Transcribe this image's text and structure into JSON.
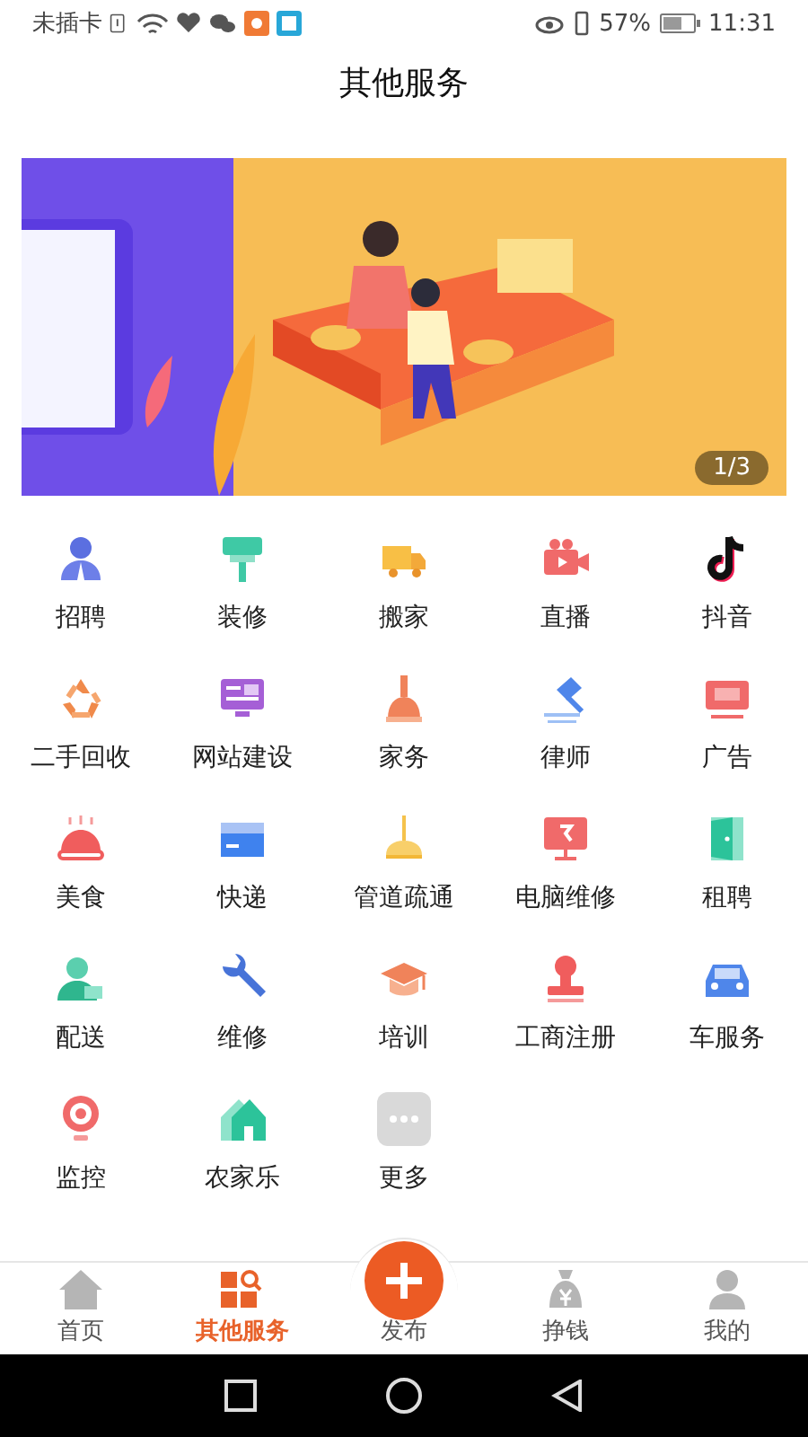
{
  "status_bar": {
    "carrier": "未插卡",
    "battery": "57%",
    "time": "11:31"
  },
  "header": {
    "title": "其他服务"
  },
  "banner": {
    "kind": "picture",
    "counter": "1/3"
  },
  "services": [
    {
      "label": "招聘"
    },
    {
      "label": "装修"
    },
    {
      "label": "搬家"
    },
    {
      "label": "直播"
    },
    {
      "label": "抖音"
    },
    {
      "label": "二手回收"
    },
    {
      "label": "网站建设"
    },
    {
      "label": "家务"
    },
    {
      "label": "律师"
    },
    {
      "label": "广告"
    },
    {
      "label": "美食"
    },
    {
      "label": "快递"
    },
    {
      "label": "管道疏通"
    },
    {
      "label": "电脑维修"
    },
    {
      "label": "租聘"
    },
    {
      "label": "配送"
    },
    {
      "label": "维修"
    },
    {
      "label": "培训"
    },
    {
      "label": "工商注册"
    },
    {
      "label": "车服务"
    },
    {
      "label": "监控"
    },
    {
      "label": "农家乐"
    },
    {
      "label": "更多"
    }
  ],
  "bottom_nav": [
    {
      "label": "首页",
      "kind": "tab",
      "selected": false
    },
    {
      "label": "其他服务",
      "kind": "tab",
      "selected": true
    },
    {
      "label": "发布",
      "kind": "publish",
      "selected": false
    },
    {
      "label": "挣钱",
      "kind": "tab",
      "selected": false
    },
    {
      "label": "我的",
      "kind": "tab",
      "selected": false
    }
  ]
}
